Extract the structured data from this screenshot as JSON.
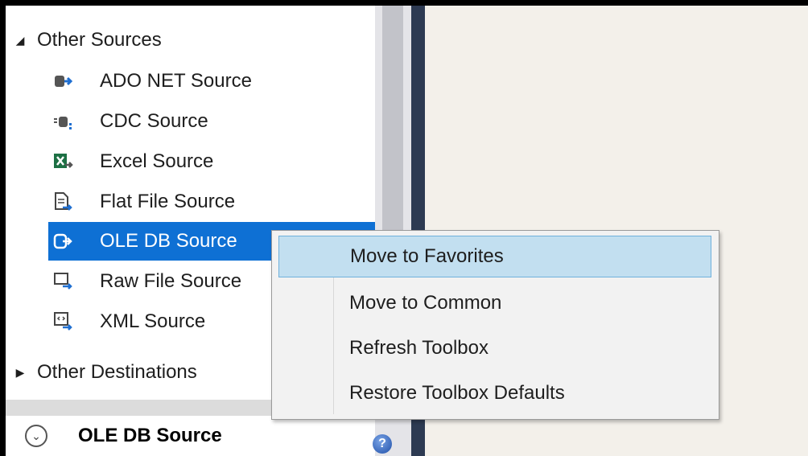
{
  "toolbox": {
    "groups": [
      {
        "label": "Other Sources",
        "expanded": true,
        "expander_icon": "triangle-expanded-icon"
      },
      {
        "label": "Other Destinations",
        "expanded": false,
        "expander_icon": "triangle-collapsed-icon"
      }
    ],
    "items": [
      {
        "label": "ADO NET Source",
        "icon": "ado-net-source-icon"
      },
      {
        "label": "CDC Source",
        "icon": "cdc-source-icon"
      },
      {
        "label": "Excel Source",
        "icon": "excel-source-icon"
      },
      {
        "label": "Flat File Source",
        "icon": "flat-file-source-icon"
      },
      {
        "label": "OLE DB Source",
        "icon": "ole-db-source-icon",
        "selected": true
      },
      {
        "label": "Raw File Source",
        "icon": "raw-file-source-icon"
      },
      {
        "label": "XML Source",
        "icon": "xml-source-icon"
      }
    ]
  },
  "properties_panel": {
    "title": "OLE DB Source",
    "collapse_icon": "chevron-down-circle-icon",
    "help_icon": "help-icon",
    "help_glyph": "?"
  },
  "context_menu": {
    "items": [
      {
        "label": "Move to Favorites",
        "highlighted": true
      },
      {
        "label": "Move to Common"
      },
      {
        "label": "Refresh Toolbox"
      },
      {
        "label": "Restore Toolbox Defaults"
      }
    ]
  },
  "colors": {
    "selection": "#0e70d4",
    "menu_hover": "#c2dff0",
    "splitter": "#2d3a52",
    "designer_background": "#f3f0ea"
  }
}
